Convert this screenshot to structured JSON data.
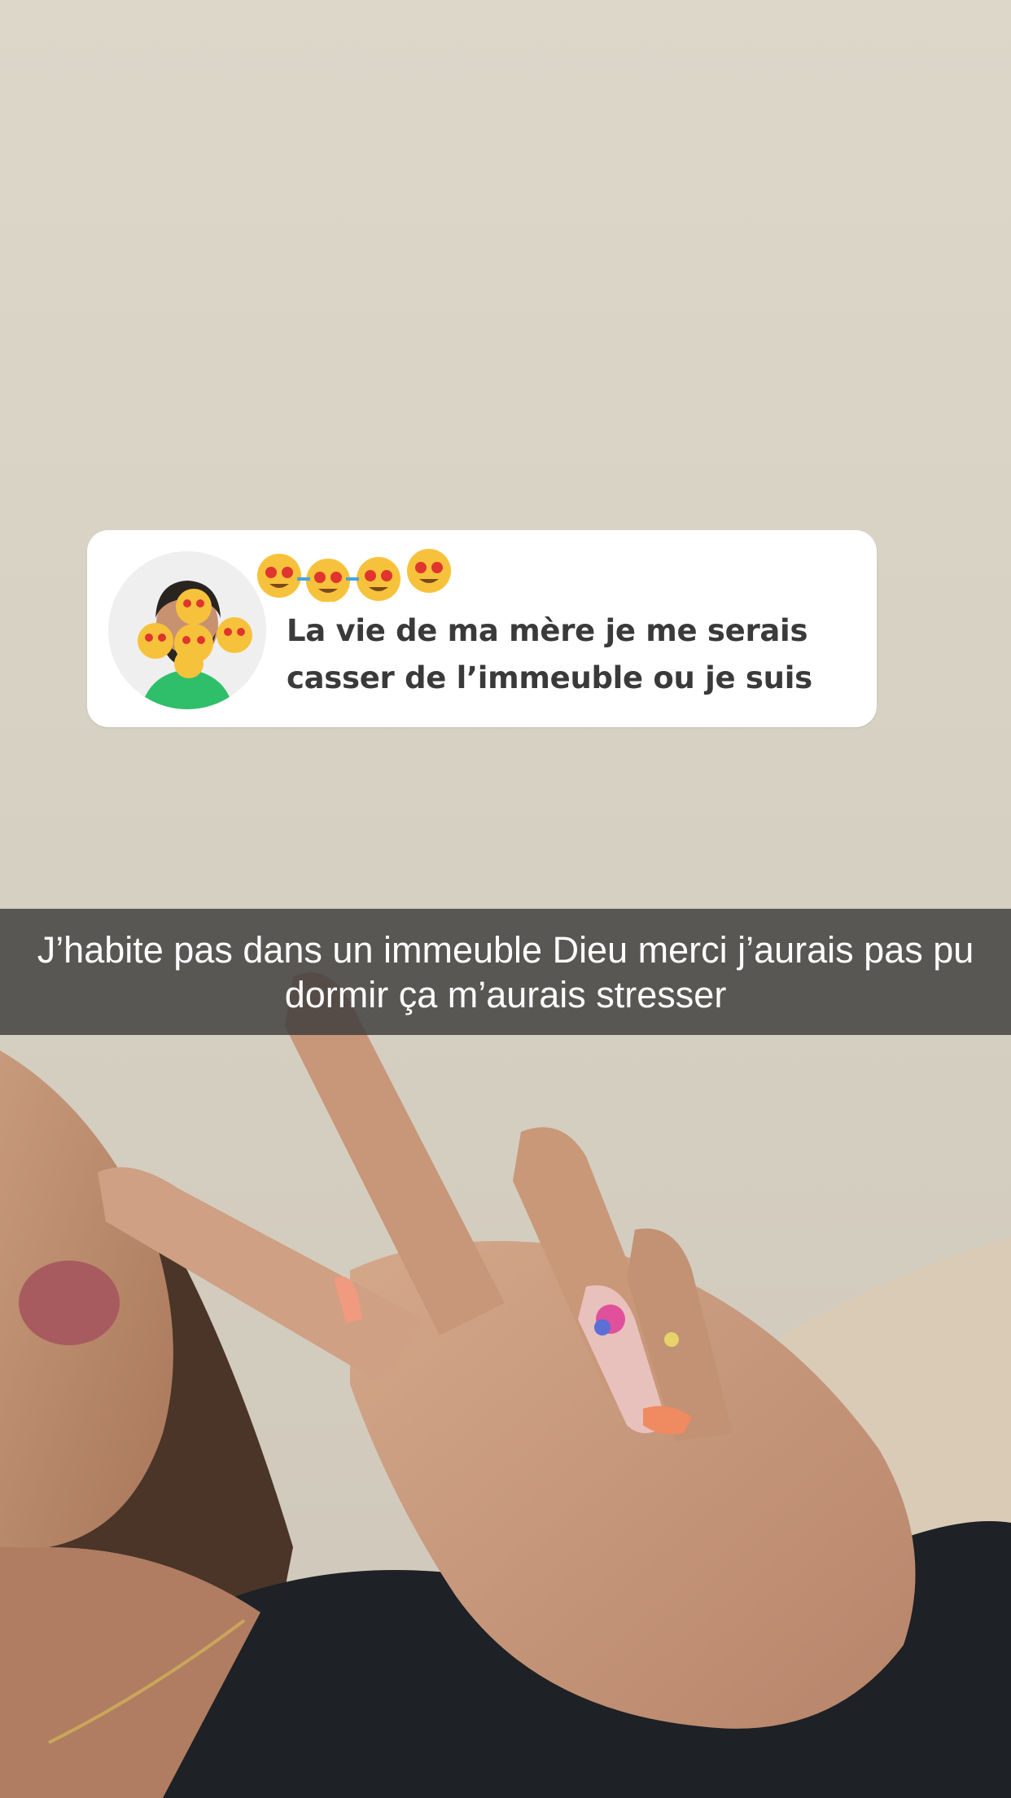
{
  "reply_sticker": {
    "text": "La vie de ma mère je me serais casser de l’immeuble ou je suis",
    "avatar_icon": "bitmoji-avatar-icon",
    "reaction_icon": "heart-eyes-emoji-icon"
  },
  "caption": {
    "text": "J’habite pas dans un immeuble Dieu merci j’aurais pas pu dormir ça m’aurais stresser"
  },
  "colors": {
    "card_background": "#ffffff",
    "caption_background": "#3c3c3c",
    "caption_text": "#ffffff",
    "reply_text": "#3a3a3a"
  }
}
